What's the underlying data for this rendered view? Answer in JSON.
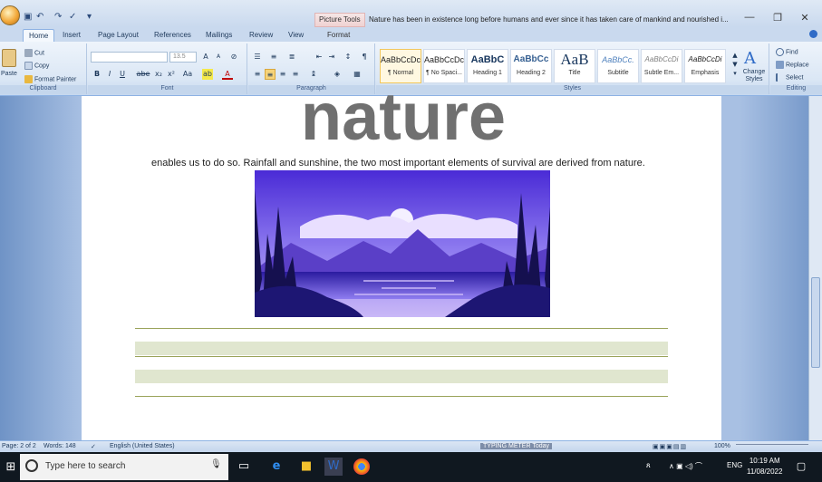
{
  "titlebar": {
    "qat": [
      "▣",
      "↶",
      "↷",
      "✓",
      "▾"
    ],
    "contextual_tab": "Picture Tools",
    "doc_title": "Nature has been in existence long before humans and ever since it has taken care of mankind and nourished i...",
    "controls": {
      "minimize": "—",
      "maximize": "❐",
      "close": "✕"
    }
  },
  "tabs": [
    {
      "label": "Home"
    },
    {
      "label": "Insert"
    },
    {
      "label": "Page Layout"
    },
    {
      "label": "References"
    },
    {
      "label": "Mailings"
    },
    {
      "label": "Review"
    },
    {
      "label": "View"
    },
    {
      "label": "Format"
    }
  ],
  "ribbon": {
    "clipboard": {
      "paste": "Paste",
      "cut": "Cut",
      "copy": "Copy",
      "format_painter": "Format Painter",
      "label": "Clipboard"
    },
    "font": {
      "size": "13.5",
      "label": "Font",
      "grow": "A",
      "shrink": "A",
      "bold": "B",
      "italic": "I",
      "underline": "U",
      "strike": "abe",
      "subscript": "x₂",
      "superscript": "x²",
      "change_case": "Aa"
    },
    "paragraph": {
      "label": "Paragraph"
    },
    "styles": {
      "label": "Styles",
      "items": [
        {
          "sample": "AaBbCcDc",
          "name": "¶ Normal"
        },
        {
          "sample": "AaBbCcDc",
          "name": "¶ No Spaci..."
        },
        {
          "sample": "AaBbC",
          "name": "Heading 1"
        },
        {
          "sample": "AaBbCc",
          "name": "Heading 2"
        },
        {
          "sample": "AaB",
          "name": "Title"
        },
        {
          "sample": "AaBbCc.",
          "name": "Subtitle"
        },
        {
          "sample": "AaBbCcDi",
          "name": "Subtle Em..."
        },
        {
          "sample": "AaBbCcDi",
          "name": "Emphasis"
        }
      ],
      "change_styles": "Change Styles"
    },
    "editing": {
      "find": "Find",
      "replace": "Replace",
      "select": "Select",
      "label": "Editing"
    }
  },
  "document": {
    "wordart": "nature",
    "body_text": "enables us to do so. Rainfall and sunshine, the two most important elements of survival are derived from nature."
  },
  "statusbar": {
    "page": "Page: 2 of 2",
    "words": "Words: 148",
    "language": "English (United States)",
    "zoom": "100%",
    "watermark": "TYPING METER Today"
  },
  "taskbar": {
    "search_placeholder": "Type here to search",
    "tray_lang": "ENG",
    "time": "10:19 AM",
    "date": "11/08/2022"
  }
}
